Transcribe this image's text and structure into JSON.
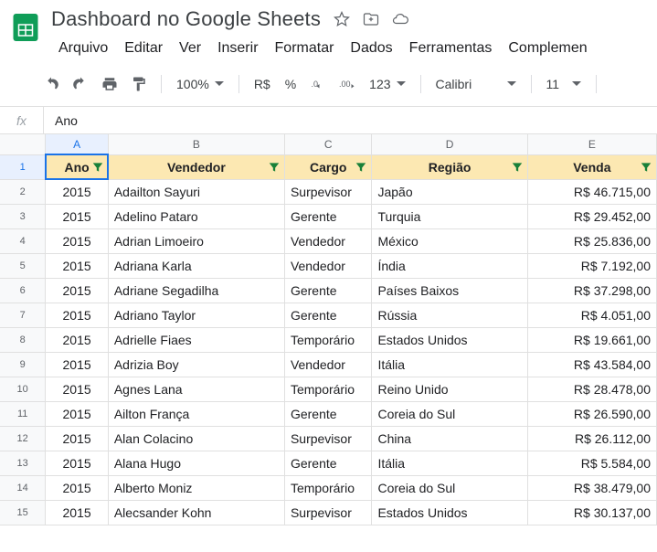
{
  "doc": {
    "title": "Dashboard no Google Sheets"
  },
  "menu": [
    "Arquivo",
    "Editar",
    "Ver",
    "Inserir",
    "Formatar",
    "Dados",
    "Ferramentas",
    "Complemen"
  ],
  "toolbar": {
    "zoom": "100%",
    "currency": "R$",
    "pct": "%",
    "fmt": "123",
    "font": "Calibri",
    "size": "11"
  },
  "fx": {
    "label": "fx",
    "value": "Ano"
  },
  "cols": [
    "A",
    "B",
    "C",
    "D",
    "E"
  ],
  "headers": [
    "Ano",
    "Vendedor",
    "Cargo",
    "Região",
    "Venda"
  ],
  "rows": [
    {
      "n": "2",
      "ano": "2015",
      "vend": "Adailton Sayuri",
      "cargo": "Surpevisor",
      "reg": "Japão",
      "venda": "R$ 46.715,00"
    },
    {
      "n": "3",
      "ano": "2015",
      "vend": "Adelino Pataro",
      "cargo": "Gerente",
      "reg": "Turquia",
      "venda": "R$ 29.452,00"
    },
    {
      "n": "4",
      "ano": "2015",
      "vend": "Adrian Limoeiro",
      "cargo": "Vendedor",
      "reg": "México",
      "venda": "R$ 25.836,00"
    },
    {
      "n": "5",
      "ano": "2015",
      "vend": "Adriana Karla",
      "cargo": "Vendedor",
      "reg": "Índia",
      "venda": "R$ 7.192,00"
    },
    {
      "n": "6",
      "ano": "2015",
      "vend": "Adriane Segadilha",
      "cargo": "Gerente",
      "reg": "Países Baixos",
      "venda": "R$ 37.298,00"
    },
    {
      "n": "7",
      "ano": "2015",
      "vend": "Adriano Taylor",
      "cargo": "Gerente",
      "reg": "Rússia",
      "venda": "R$ 4.051,00"
    },
    {
      "n": "8",
      "ano": "2015",
      "vend": "Adrielle Fiaes",
      "cargo": "Temporário",
      "reg": "Estados Unidos",
      "venda": "R$ 19.661,00"
    },
    {
      "n": "9",
      "ano": "2015",
      "vend": "Adrizia Boy",
      "cargo": "Vendedor",
      "reg": "Itália",
      "venda": "R$ 43.584,00"
    },
    {
      "n": "10",
      "ano": "2015",
      "vend": "Agnes Lana",
      "cargo": "Temporário",
      "reg": "Reino Unido",
      "venda": "R$ 28.478,00"
    },
    {
      "n": "11",
      "ano": "2015",
      "vend": "Ailton França",
      "cargo": "Gerente",
      "reg": "Coreia do Sul",
      "venda": "R$ 26.590,00"
    },
    {
      "n": "12",
      "ano": "2015",
      "vend": "Alan Colacino",
      "cargo": "Surpevisor",
      "reg": "China",
      "venda": "R$ 26.112,00"
    },
    {
      "n": "13",
      "ano": "2015",
      "vend": "Alana Hugo",
      "cargo": "Gerente",
      "reg": "Itália",
      "venda": "R$ 5.584,00"
    },
    {
      "n": "14",
      "ano": "2015",
      "vend": "Alberto Moniz",
      "cargo": "Temporário",
      "reg": "Coreia do Sul",
      "venda": "R$ 38.479,00"
    },
    {
      "n": "15",
      "ano": "2015",
      "vend": "Alecsander Kohn",
      "cargo": "Surpevisor",
      "reg": "Estados Unidos",
      "venda": "R$ 30.137,00"
    }
  ]
}
